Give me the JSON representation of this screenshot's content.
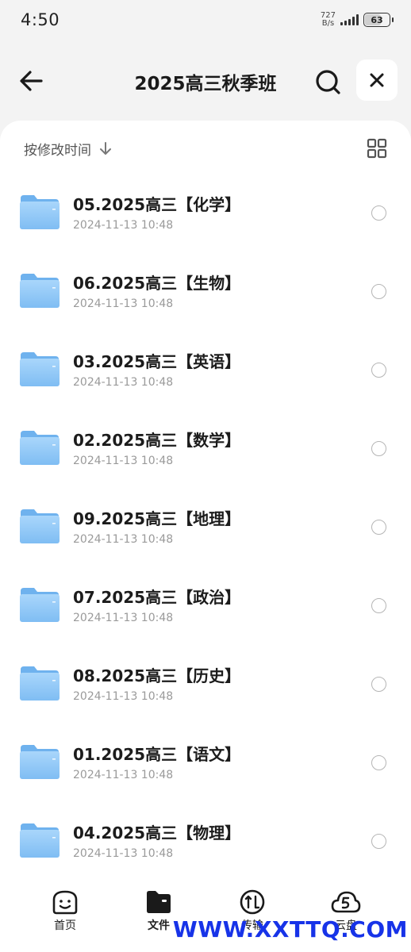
{
  "status_bar": {
    "time": "4:50",
    "net_speed_value": "727",
    "net_speed_unit": "B/s",
    "battery": "63"
  },
  "header": {
    "title": "2025高三秋季班",
    "back_icon": "arrow-left-icon",
    "search_icon": "search-icon",
    "close_icon": "close-icon"
  },
  "sort": {
    "label": "按修改时间",
    "direction_icon": "arrow-down-icon",
    "view_toggle_icon": "grid-view-icon"
  },
  "files": [
    {
      "name": "05.2025高三【化学】",
      "date": "2024-11-13 10:48"
    },
    {
      "name": "06.2025高三【生物】",
      "date": "2024-11-13 10:48"
    },
    {
      "name": "03.2025高三【英语】",
      "date": "2024-11-13 10:48"
    },
    {
      "name": "02.2025高三【数学】",
      "date": "2024-11-13 10:48"
    },
    {
      "name": "09.2025高三【地理】",
      "date": "2024-11-13 10:48"
    },
    {
      "name": "07.2025高三【政治】",
      "date": "2024-11-13 10:48"
    },
    {
      "name": "08.2025高三【历史】",
      "date": "2024-11-13 10:48"
    },
    {
      "name": "01.2025高三【语文】",
      "date": "2024-11-13 10:48"
    },
    {
      "name": "04.2025高三【物理】",
      "date": "2024-11-13 10:48"
    }
  ],
  "bottom_nav": {
    "items": [
      {
        "label": "首页",
        "icon": "home-face-icon"
      },
      {
        "label": "文件",
        "icon": "folder-icon"
      },
      {
        "label": "传输",
        "icon": "transfer-icon"
      },
      {
        "label": "云盘",
        "icon": "cloud-icon"
      }
    ],
    "watermark": "WWW.XXTTQ.COM"
  },
  "colors": {
    "folder": "#8cc4f5",
    "panel": "#ffffff",
    "background": "#f3f3f3",
    "watermark": "#1733e8"
  }
}
